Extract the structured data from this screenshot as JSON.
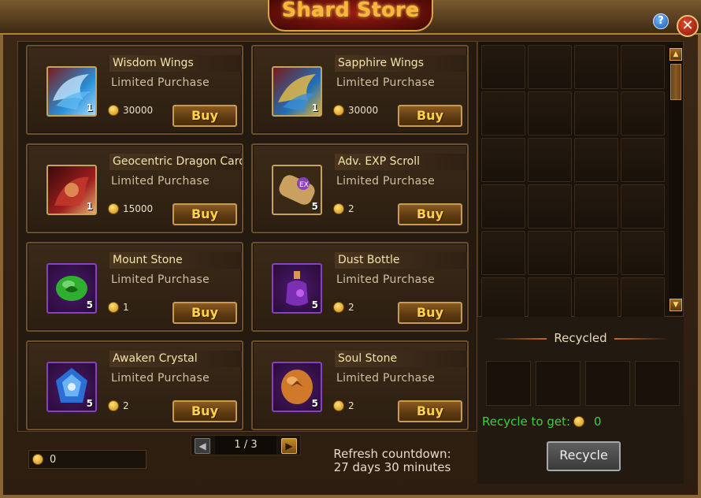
{
  "window": {
    "title": "Shard Store",
    "help_label": "?",
    "close_label": "✕"
  },
  "store": {
    "items": [
      {
        "name": "Wisdom Wings",
        "limit": "Limited Purchase",
        "price": "30000",
        "qty": "1",
        "buy_label": "Buy",
        "icon": "wings-icon",
        "icon_color": "#2a8fd6"
      },
      {
        "name": "Sapphire Wings",
        "limit": "Limited Purchase",
        "price": "30000",
        "qty": "1",
        "buy_label": "Buy",
        "icon": "wings-icon",
        "icon_color": "#1f6fb8"
      },
      {
        "name": "Geocentric Dragon Card",
        "limit": "Limited Purchase",
        "price": "15000",
        "qty": "1",
        "buy_label": "Buy",
        "icon": "dragon-card-icon",
        "icon_color": "#9e1f1f"
      },
      {
        "name": "Adv. EXP Scroll",
        "limit": "Limited Purchase",
        "price": "2",
        "qty": "5",
        "buy_label": "Buy",
        "icon": "scroll-icon",
        "icon_color": "#b0874a"
      },
      {
        "name": "Mount Stone",
        "limit": "Limited Purchase",
        "price": "1",
        "qty": "5",
        "buy_label": "Buy",
        "icon": "green-stone-icon",
        "icon_color": "#2fae2f"
      },
      {
        "name": "Dust Bottle",
        "limit": "Limited Purchase",
        "price": "2",
        "qty": "5",
        "buy_label": "Buy",
        "icon": "potion-bottle-icon",
        "icon_color": "#7b2fb5"
      },
      {
        "name": "Awaken Crystal",
        "limit": "Limited Purchase",
        "price": "2",
        "qty": "5",
        "buy_label": "Buy",
        "icon": "crystal-icon",
        "icon_color": "#2a6fd6"
      },
      {
        "name": "Soul Stone",
        "limit": "Limited Purchase",
        "price": "2",
        "qty": "5",
        "buy_label": "Buy",
        "icon": "soul-stone-icon",
        "icon_color": "#d0792a"
      }
    ],
    "currency_amount": "0",
    "pager": {
      "label": "1 / 3"
    },
    "refresh": {
      "line1": "Refresh countdown:",
      "line2": "27 days 30 minutes"
    }
  },
  "recycle": {
    "title": "Recycled",
    "get_label": "Recycle to get:",
    "get_amount": "0",
    "button_label": "Recycle"
  }
}
